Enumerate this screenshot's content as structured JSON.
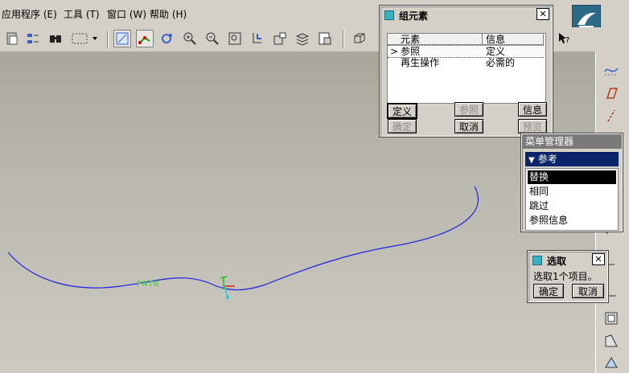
{
  "menu": {
    "items": [
      "应用程序 (E)",
      "工具 (T)",
      "窗口 (W)",
      "帮助 (H)"
    ]
  },
  "group_dialog": {
    "title": "组元素",
    "columns": [
      "元素",
      "信息"
    ],
    "rows": [
      {
        "marker": ">",
        "element": "参照",
        "info": "定义"
      },
      {
        "marker": "",
        "element": "再生操作",
        "info": "必需的"
      }
    ],
    "buttons": {
      "define": "定义",
      "refer": "参照",
      "info": "信息",
      "ok": "确定",
      "cancel": "取消",
      "preview": "预览"
    }
  },
  "menu_manager": {
    "title": "菜单管理器",
    "header": "参考",
    "items": [
      "替换",
      "相同",
      "跳过",
      "参照信息"
    ],
    "selected_index": 0
  },
  "select_dialog": {
    "title": "选取",
    "message": "选取1个项目。",
    "ok": "确定",
    "cancel": "取消"
  },
  "canvas": {
    "point_label": "PNT0"
  },
  "colors": {
    "curve": "#2020e0",
    "point_label": "#33d633",
    "menu_header_bg": "#0a246a",
    "selected_item_bg": "#000000",
    "logo_bg": "#2a6a86"
  }
}
